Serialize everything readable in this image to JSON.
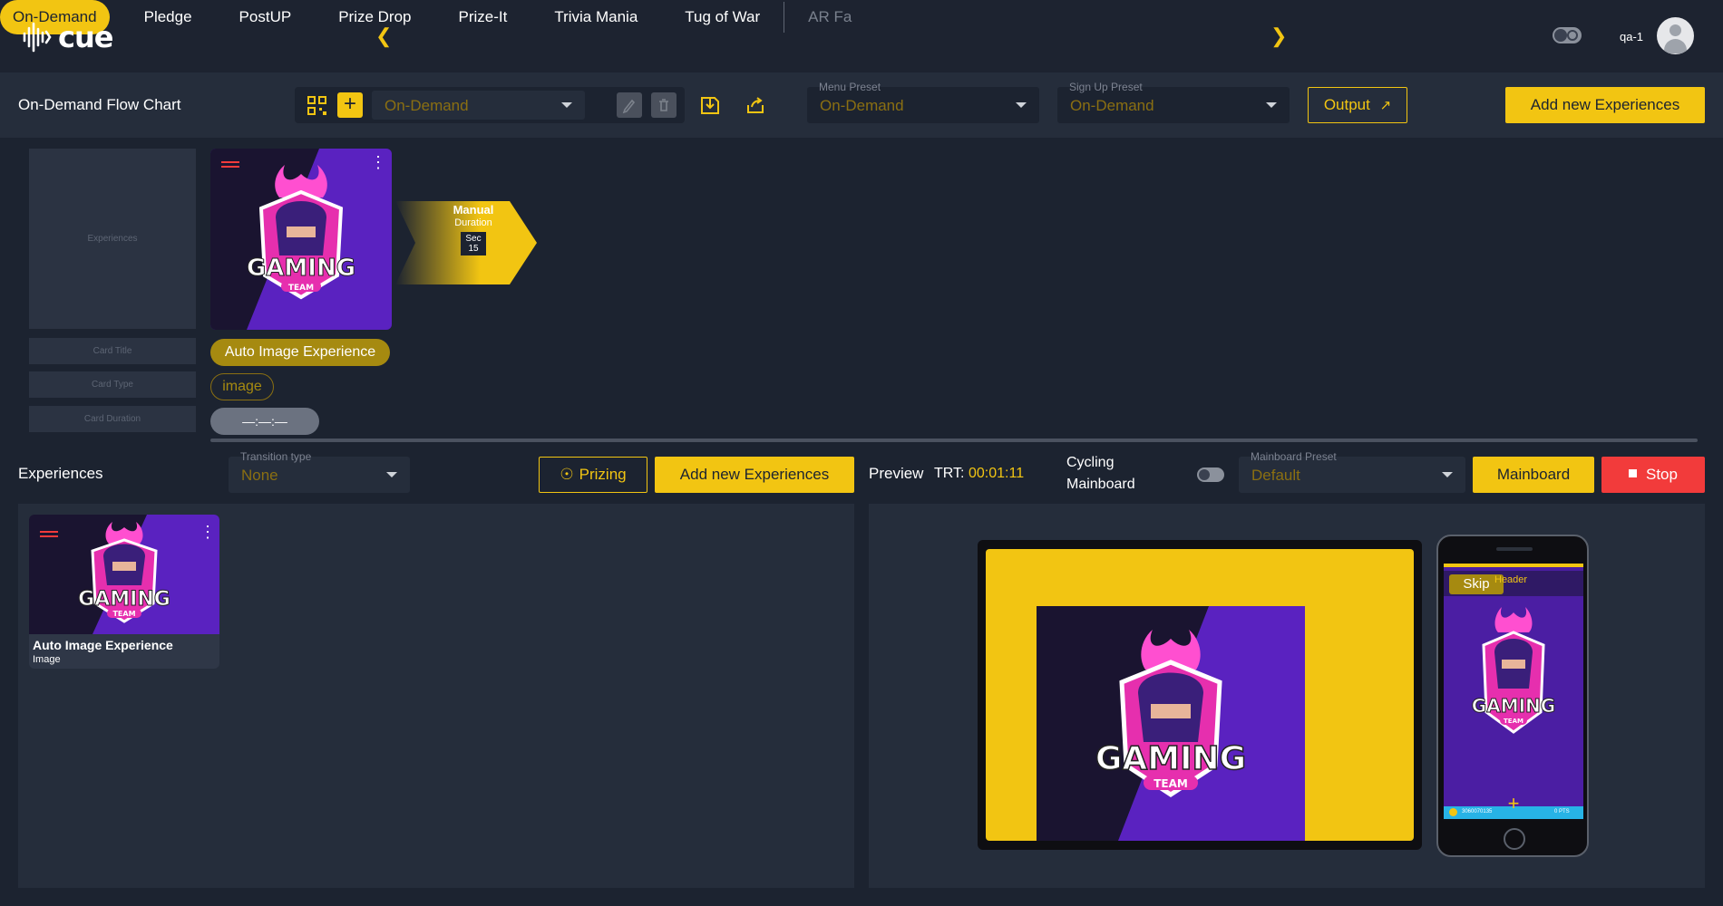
{
  "app": {
    "logo": "cue",
    "user": "qa-1"
  },
  "nav": {
    "tabs": [
      "On-Demand",
      "Pledge",
      "PostUP",
      "Prize Drop",
      "Prize-It",
      "Trivia Mania",
      "Tug of War",
      "AR Fa"
    ]
  },
  "toolbar": {
    "page_title": "On-Demand Flow Chart",
    "flow_select": "On-Demand",
    "menu_preset_label": "Menu Preset",
    "menu_preset_value": "On-Demand",
    "signup_preset_label": "Sign Up Preset",
    "signup_preset_value": "On-Demand",
    "output_label": "Output",
    "add_new_label": "Add new Experiences"
  },
  "flow": {
    "placeholders": {
      "experiences": "Experiences",
      "card_title": "Card Title",
      "card_type": "Card Type",
      "card_duration": "Card Duration"
    },
    "card": {
      "title": "Auto Image Experience",
      "type": "image",
      "duration": "—:—:—"
    },
    "arrow": {
      "mode": "Manual",
      "sub": "Duration",
      "unit": "Sec",
      "value": "15"
    }
  },
  "experiences": {
    "title": "Experiences",
    "transition_label": "Transition type",
    "transition_value": "None",
    "prizing_label": "Prizing",
    "add_new_label": "Add new Experiences",
    "items": [
      {
        "title": "Auto Image Experience",
        "type": "Image"
      }
    ]
  },
  "preview": {
    "label": "Preview",
    "trt_label": "TRT:",
    "trt_value": "00:01:11",
    "cycling_label_1": "Cycling",
    "cycling_label_2": "Mainboard",
    "mainboard_preset_label": "Mainboard Preset",
    "mainboard_preset_value": "Default",
    "mainboard_btn": "Mainboard",
    "stop_btn": "Stop",
    "phone_skip": "Skip",
    "phone_header": "Header",
    "phone_footer_left": "3060070135",
    "phone_footer_right": "0 PTS"
  },
  "artwork": {
    "text_main": "GAMING",
    "text_sub": "TEAM"
  },
  "colors": {
    "accent": "#f2c512",
    "bg": "#1c2330",
    "panel": "#252d3b",
    "danger": "#f23b3b",
    "art_purple": "#4b1ea3"
  }
}
